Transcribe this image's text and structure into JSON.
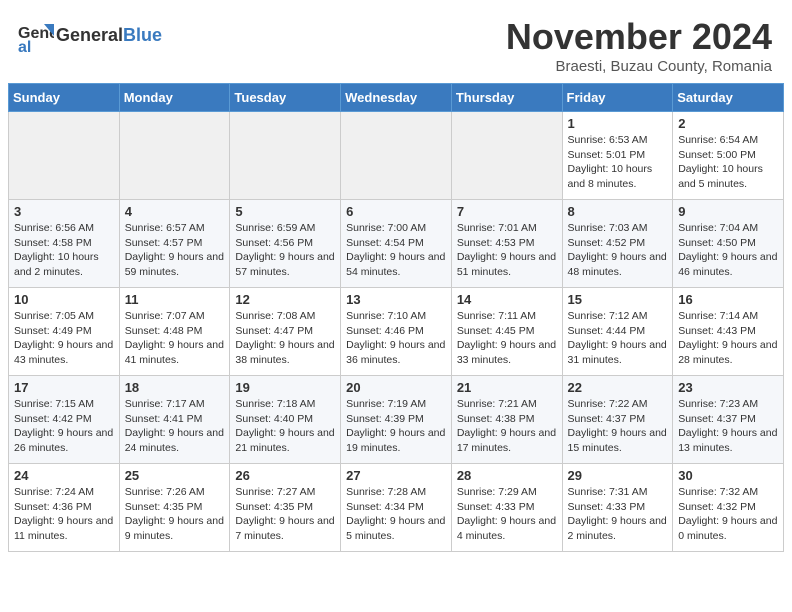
{
  "header": {
    "logo_general": "General",
    "logo_blue": "Blue",
    "month_title": "November 2024",
    "location": "Braesti, Buzau County, Romania"
  },
  "days_of_week": [
    "Sunday",
    "Monday",
    "Tuesday",
    "Wednesday",
    "Thursday",
    "Friday",
    "Saturday"
  ],
  "weeks": [
    {
      "days": [
        {
          "number": "",
          "info": ""
        },
        {
          "number": "",
          "info": ""
        },
        {
          "number": "",
          "info": ""
        },
        {
          "number": "",
          "info": ""
        },
        {
          "number": "",
          "info": ""
        },
        {
          "number": "1",
          "info": "Sunrise: 6:53 AM\nSunset: 5:01 PM\nDaylight: 10 hours and 8 minutes."
        },
        {
          "number": "2",
          "info": "Sunrise: 6:54 AM\nSunset: 5:00 PM\nDaylight: 10 hours and 5 minutes."
        }
      ]
    },
    {
      "days": [
        {
          "number": "3",
          "info": "Sunrise: 6:56 AM\nSunset: 4:58 PM\nDaylight: 10 hours and 2 minutes."
        },
        {
          "number": "4",
          "info": "Sunrise: 6:57 AM\nSunset: 4:57 PM\nDaylight: 9 hours and 59 minutes."
        },
        {
          "number": "5",
          "info": "Sunrise: 6:59 AM\nSunset: 4:56 PM\nDaylight: 9 hours and 57 minutes."
        },
        {
          "number": "6",
          "info": "Sunrise: 7:00 AM\nSunset: 4:54 PM\nDaylight: 9 hours and 54 minutes."
        },
        {
          "number": "7",
          "info": "Sunrise: 7:01 AM\nSunset: 4:53 PM\nDaylight: 9 hours and 51 minutes."
        },
        {
          "number": "8",
          "info": "Sunrise: 7:03 AM\nSunset: 4:52 PM\nDaylight: 9 hours and 48 minutes."
        },
        {
          "number": "9",
          "info": "Sunrise: 7:04 AM\nSunset: 4:50 PM\nDaylight: 9 hours and 46 minutes."
        }
      ]
    },
    {
      "days": [
        {
          "number": "10",
          "info": "Sunrise: 7:05 AM\nSunset: 4:49 PM\nDaylight: 9 hours and 43 minutes."
        },
        {
          "number": "11",
          "info": "Sunrise: 7:07 AM\nSunset: 4:48 PM\nDaylight: 9 hours and 41 minutes."
        },
        {
          "number": "12",
          "info": "Sunrise: 7:08 AM\nSunset: 4:47 PM\nDaylight: 9 hours and 38 minutes."
        },
        {
          "number": "13",
          "info": "Sunrise: 7:10 AM\nSunset: 4:46 PM\nDaylight: 9 hours and 36 minutes."
        },
        {
          "number": "14",
          "info": "Sunrise: 7:11 AM\nSunset: 4:45 PM\nDaylight: 9 hours and 33 minutes."
        },
        {
          "number": "15",
          "info": "Sunrise: 7:12 AM\nSunset: 4:44 PM\nDaylight: 9 hours and 31 minutes."
        },
        {
          "number": "16",
          "info": "Sunrise: 7:14 AM\nSunset: 4:43 PM\nDaylight: 9 hours and 28 minutes."
        }
      ]
    },
    {
      "days": [
        {
          "number": "17",
          "info": "Sunrise: 7:15 AM\nSunset: 4:42 PM\nDaylight: 9 hours and 26 minutes."
        },
        {
          "number": "18",
          "info": "Sunrise: 7:17 AM\nSunset: 4:41 PM\nDaylight: 9 hours and 24 minutes."
        },
        {
          "number": "19",
          "info": "Sunrise: 7:18 AM\nSunset: 4:40 PM\nDaylight: 9 hours and 21 minutes."
        },
        {
          "number": "20",
          "info": "Sunrise: 7:19 AM\nSunset: 4:39 PM\nDaylight: 9 hours and 19 minutes."
        },
        {
          "number": "21",
          "info": "Sunrise: 7:21 AM\nSunset: 4:38 PM\nDaylight: 9 hours and 17 minutes."
        },
        {
          "number": "22",
          "info": "Sunrise: 7:22 AM\nSunset: 4:37 PM\nDaylight: 9 hours and 15 minutes."
        },
        {
          "number": "23",
          "info": "Sunrise: 7:23 AM\nSunset: 4:37 PM\nDaylight: 9 hours and 13 minutes."
        }
      ]
    },
    {
      "days": [
        {
          "number": "24",
          "info": "Sunrise: 7:24 AM\nSunset: 4:36 PM\nDaylight: 9 hours and 11 minutes."
        },
        {
          "number": "25",
          "info": "Sunrise: 7:26 AM\nSunset: 4:35 PM\nDaylight: 9 hours and 9 minutes."
        },
        {
          "number": "26",
          "info": "Sunrise: 7:27 AM\nSunset: 4:35 PM\nDaylight: 9 hours and 7 minutes."
        },
        {
          "number": "27",
          "info": "Sunrise: 7:28 AM\nSunset: 4:34 PM\nDaylight: 9 hours and 5 minutes."
        },
        {
          "number": "28",
          "info": "Sunrise: 7:29 AM\nSunset: 4:33 PM\nDaylight: 9 hours and 4 minutes."
        },
        {
          "number": "29",
          "info": "Sunrise: 7:31 AM\nSunset: 4:33 PM\nDaylight: 9 hours and 2 minutes."
        },
        {
          "number": "30",
          "info": "Sunrise: 7:32 AM\nSunset: 4:32 PM\nDaylight: 9 hours and 0 minutes."
        }
      ]
    }
  ]
}
